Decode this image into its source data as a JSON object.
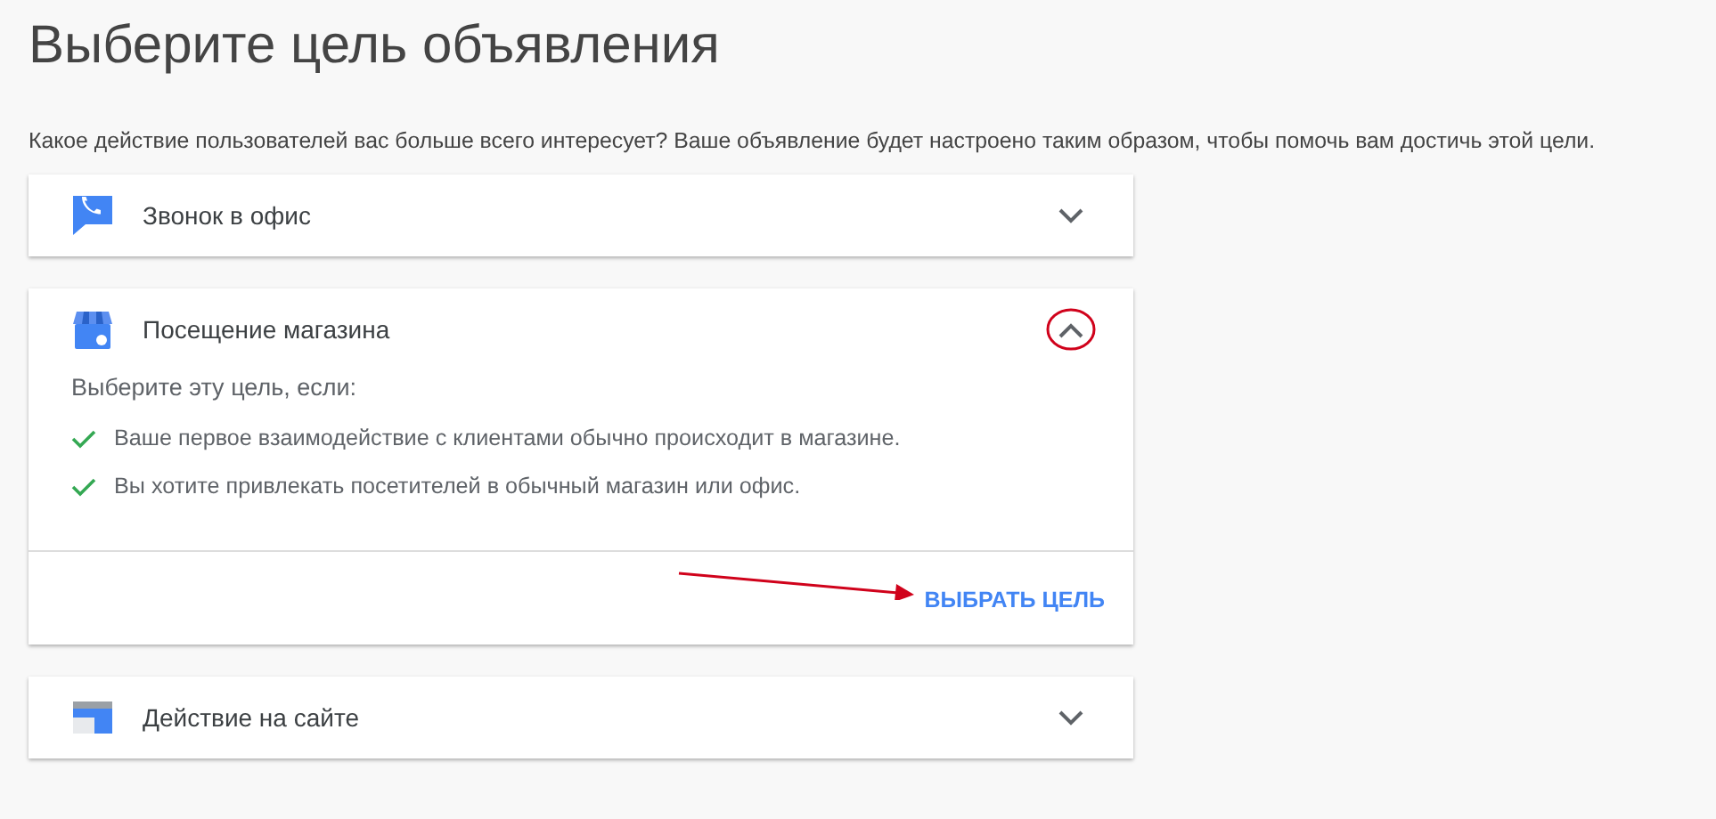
{
  "title": "Выберите цель объявления",
  "subtitle": "Какое действие пользователей вас больше всего интересует? Ваше объявление будет настроено таким образом, чтобы помочь вам достичь этой цели.",
  "goals": [
    {
      "label": "Звонок в офис",
      "expanded": false
    },
    {
      "label": "Посещение магазина",
      "expanded": true,
      "intro": "Выберите эту цель, если:",
      "reasons": [
        "Ваше первое взаимодействие с клиентами обычно происходит в магазине.",
        "Вы хотите привлекать посетителей в обычный магазин или офис."
      ],
      "action": "ВЫБРАТЬ ЦЕЛЬ"
    },
    {
      "label": "Действие на сайте",
      "expanded": false
    }
  ]
}
